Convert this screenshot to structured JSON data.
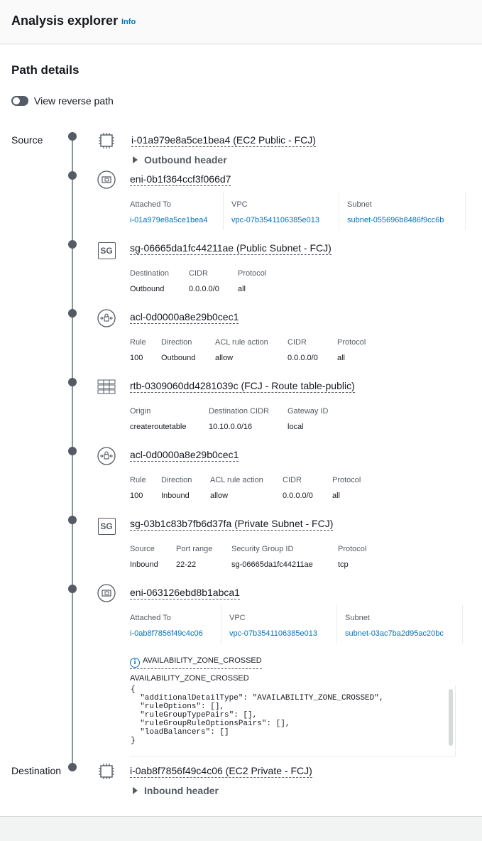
{
  "header": {
    "title": "Analysis explorer",
    "info_label": "Info"
  },
  "path": {
    "title": "Path details",
    "toggle_label": "View reverse path",
    "source_label": "Source",
    "destination_label": "Destination"
  },
  "source": {
    "title": "i-01a979e8a5ce1bea4 (EC2 Public - FCJ)",
    "expander": "Outbound header"
  },
  "eni1": {
    "title": "eni-0b1f364ccf3f066d7",
    "headers": [
      "Attached To",
      "VPC",
      "Subnet"
    ],
    "values": [
      "i-01a979e8a5ce1bea4",
      "vpc-07b3541106385e013",
      "subnet-055696b8486f9cc6b"
    ]
  },
  "sg1": {
    "title": "sg-06665da1fc44211ae (Public Subnet - FCJ)",
    "headers": [
      "Destination",
      "CIDR",
      "Protocol"
    ],
    "values": [
      "Outbound",
      "0.0.0.0/0",
      "all"
    ]
  },
  "acl1": {
    "title": "acl-0d0000a8e29b0cec1",
    "headers": [
      "Rule",
      "Direction",
      "ACL rule action",
      "CIDR",
      "Protocol"
    ],
    "values": [
      "100",
      "Outbound",
      "allow",
      "0.0.0.0/0",
      "all"
    ]
  },
  "rtb": {
    "title": "rtb-0309060dd4281039c (FCJ - Route table-public)",
    "headers": [
      "Origin",
      "Destination CIDR",
      "Gateway ID"
    ],
    "values": [
      "createroutetable",
      "10.10.0.0/16",
      "local"
    ]
  },
  "acl2": {
    "title": "acl-0d0000a8e29b0cec1",
    "headers": [
      "Rule",
      "Direction",
      "ACL rule action",
      "CIDR",
      "Protocol"
    ],
    "values": [
      "100",
      "Inbound",
      "allow",
      "0.0.0.0/0",
      "all"
    ]
  },
  "sg2": {
    "title": "sg-03b1c83b7fb6d37fa (Private Subnet - FCJ)",
    "headers": [
      "Source",
      "Port range",
      "Security Group ID",
      "Protocol"
    ],
    "values": [
      "Inbound",
      "22-22",
      "sg-06665da1fc44211ae",
      "tcp"
    ]
  },
  "eni2": {
    "title": "eni-063126ebd8b1abca1",
    "headers": [
      "Attached To",
      "VPC",
      "Subnet"
    ],
    "values": [
      "i-0ab8f7856f49c4c06",
      "vpc-07b3541106385e013",
      "subnet-03ac7ba2d95ac20bc"
    ],
    "warning_label": "AVAILABILITY_ZONE_CROSSED",
    "warning_subtitle": "AVAILABILITY_ZONE_CROSSED",
    "json_lines": [
      "{",
      "  \"additionalDetailType\": \"AVAILABILITY_ZONE_CROSSED\",",
      "  \"ruleOptions\": [],",
      "  \"ruleGroupTypePairs\": [],",
      "  \"ruleGroupRuleOptionsPairs\": [],",
      "  \"loadBalancers\": []",
      "}"
    ]
  },
  "destination": {
    "title": "i-0ab8f7856f49c4c06 (EC2 Private - FCJ)",
    "expander": "Inbound header"
  },
  "icons": {
    "instance": "ec2-instance-icon",
    "eni": "network-interface-icon",
    "sg": "security-group-icon",
    "acl": "network-acl-icon",
    "rtb": "route-table-icon",
    "info": "info-icon"
  },
  "colors": {
    "link": "#0073bb",
    "timeline": "#545b64"
  }
}
